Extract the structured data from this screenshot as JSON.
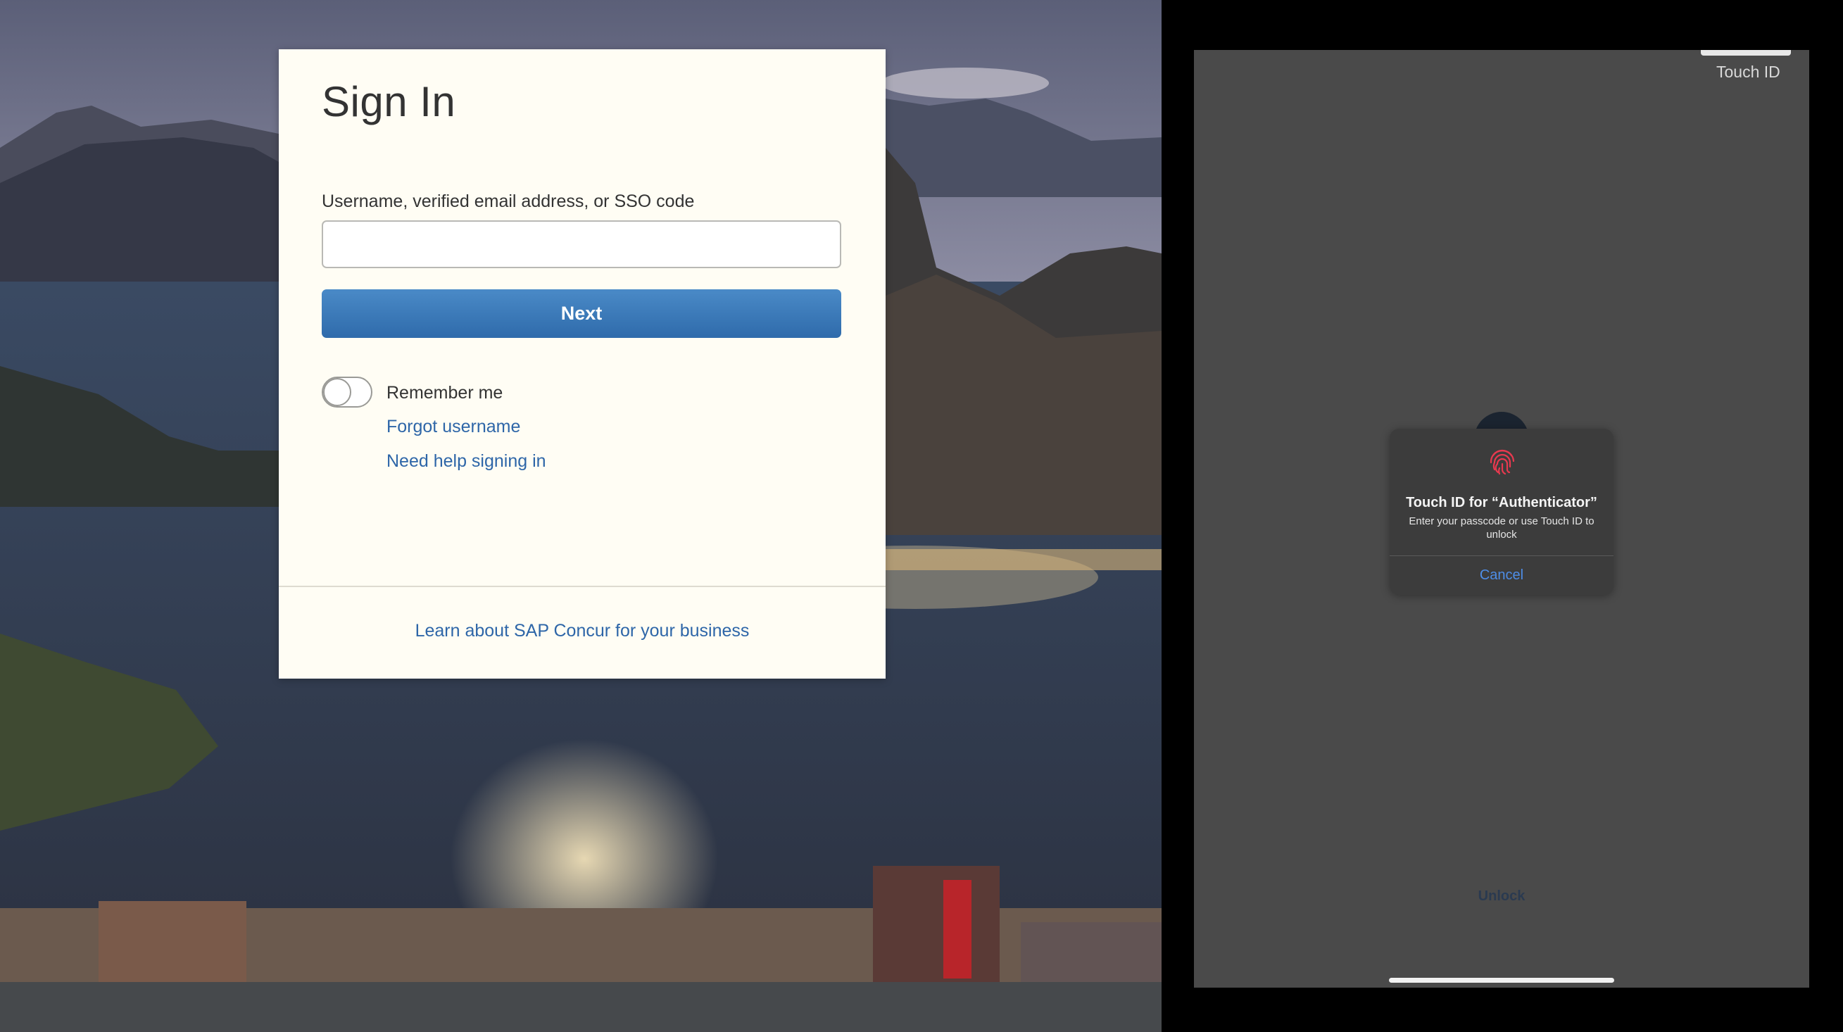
{
  "signin": {
    "title": "Sign In",
    "username_label": "Username, verified email address, or SSO code",
    "username_value": "",
    "next_label": "Next",
    "remember_label": "Remember me",
    "remember_checked": false,
    "forgot_username": "Forgot username",
    "help_signing_in": "Need help signing in",
    "learn_link": "Learn about SAP Concur for your business"
  },
  "colors": {
    "next_button": "#3a78b8",
    "link": "#2e66a8",
    "card_bg": "#fffdf4",
    "ipad_bg": "#4a4a4a",
    "cancel": "#4e8ee8",
    "fingerprint": "#e8394f"
  },
  "ipad": {
    "corner_label": "Touch ID",
    "dialog": {
      "icon": "fingerprint-icon",
      "title": "Touch ID for “Authenticator”",
      "message": "Enter your passcode or use Touch ID to unlock",
      "cancel_label": "Cancel"
    },
    "unlock_label": "Unlock"
  }
}
